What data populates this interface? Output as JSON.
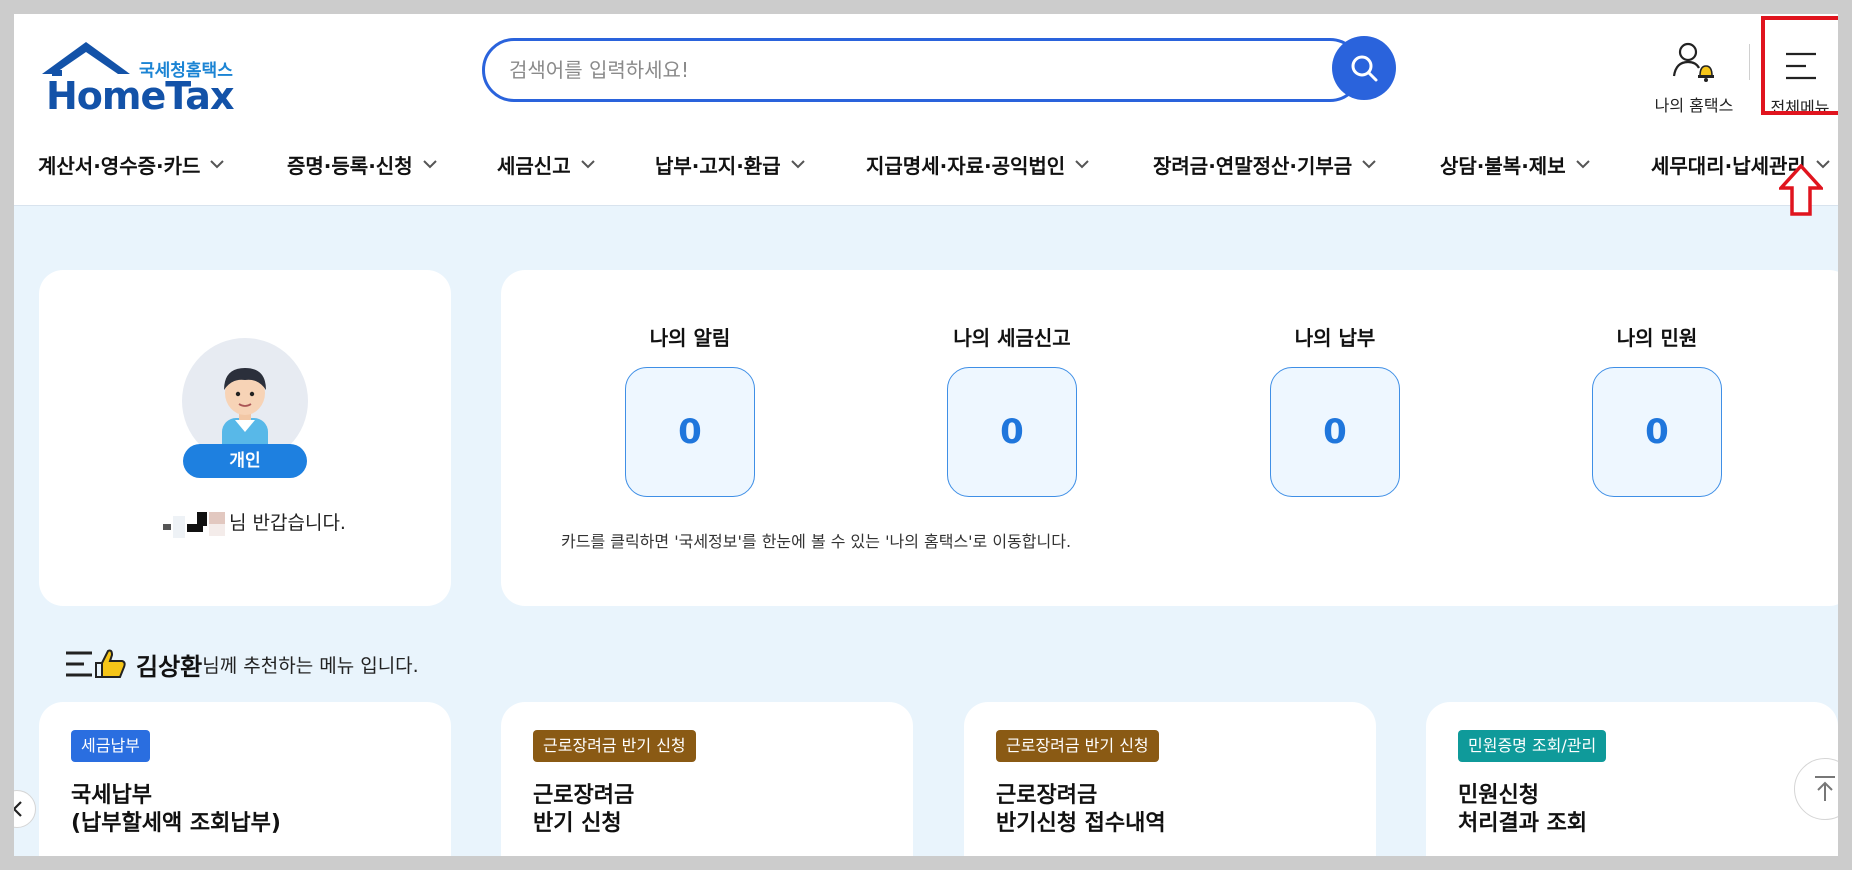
{
  "header": {
    "logo_small": "국세청홈택스",
    "logo_main": "HomeTax",
    "search_placeholder": "검색어를 입력하세요!",
    "my_hometax_label": "나의 홈택스",
    "all_menu_label": "전체메뉴"
  },
  "nav": {
    "items": [
      {
        "label": "계산서·영수증·카드"
      },
      {
        "label": "증명·등록·신청"
      },
      {
        "label": "세금신고"
      },
      {
        "label": "납부·고지·환급"
      },
      {
        "label": "지급명세·자료·공익법인"
      },
      {
        "label": "장려금·연말정산·기부금"
      },
      {
        "label": "상담·불복·제보"
      },
      {
        "label": "세무대리·납세관리"
      }
    ]
  },
  "profile": {
    "badge": "개인",
    "welcome_suffix": "님 반갑습니다."
  },
  "stats": {
    "items": [
      {
        "title": "나의 알림",
        "value": "0"
      },
      {
        "title": "나의 세금신고",
        "value": "0"
      },
      {
        "title": "나의 납부",
        "value": "0"
      },
      {
        "title": "나의 민원",
        "value": "0"
      }
    ],
    "note": "카드를 클릭하면 '국세정보'를 한눈에 볼 수 있는 '나의 홈택스'로 이동합니다."
  },
  "recommend": {
    "name": "김상환",
    "suffix": "님께 추천하는 메뉴 입니다.",
    "cards": [
      {
        "tag": "세금납부",
        "tag_color": "#2a6ee0",
        "line1": "국세납부",
        "line2": "(납부할세액 조회납부)"
      },
      {
        "tag": "근로장려금 반기 신청",
        "tag_color": "#8a5a14",
        "line1": "근로장려금",
        "line2": "반기 신청"
      },
      {
        "tag": "근로장려금 반기 신청",
        "tag_color": "#8a5a14",
        "line1": "근로장려금",
        "line2": "반기신청 접수내역"
      },
      {
        "tag": "민원증명 조회/관리",
        "tag_color": "#0f9a9a",
        "line1": "민원신청",
        "line2": "처리결과 조회"
      }
    ]
  },
  "colors": {
    "primary": "#2a63dc",
    "highlight": "#e0141e",
    "background": "#e9f4fc"
  }
}
